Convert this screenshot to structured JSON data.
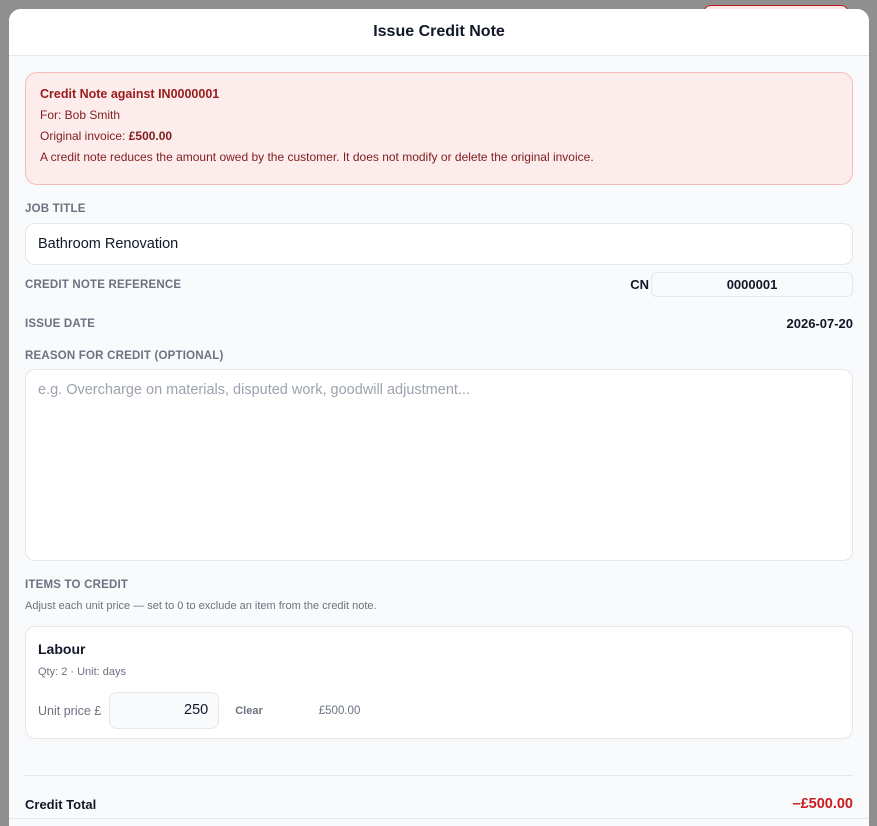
{
  "modal": {
    "title": "Issue Credit Note"
  },
  "alert": {
    "title": "Credit Note against IN0000001",
    "customer": "For: Bob Smith",
    "original_invoice_prefix": "Original invoice:",
    "original_invoice_amount": "£500.00",
    "note": "A credit note reduces the amount owed by the customer. It does not modify or delete the original invoice."
  },
  "job_title": {
    "label": "JOB TITLE",
    "value": "Bathroom Renovation"
  },
  "reference": {
    "label": "CREDIT NOTE REFERENCE",
    "prefix": "CN",
    "value": "0000001"
  },
  "issue_date": {
    "label": "ISSUE DATE",
    "value": "2026-07-20"
  },
  "reason": {
    "label": "REASON FOR CREDIT (OPTIONAL)",
    "placeholder": "e.g. Overcharge on materials, disputed work, goodwill adjustment..."
  },
  "items": {
    "label": "ITEMS TO CREDIT",
    "hint": "Adjust each unit price — set to 0 to exclude an item from the credit note.",
    "list": [
      {
        "name": "Labour",
        "meta": "Qty: 2  ·  Unit: days",
        "unit_price_label": "Unit price £",
        "unit_price": "250",
        "clear_label": "Clear",
        "line_total": "£500.00"
      }
    ]
  },
  "total": {
    "label": "Credit Total",
    "value": "–£500.00"
  },
  "colors": {
    "accent_red": "#c81e1e",
    "alert_bg": "#fdecec",
    "alert_border": "#f5bcbc"
  }
}
